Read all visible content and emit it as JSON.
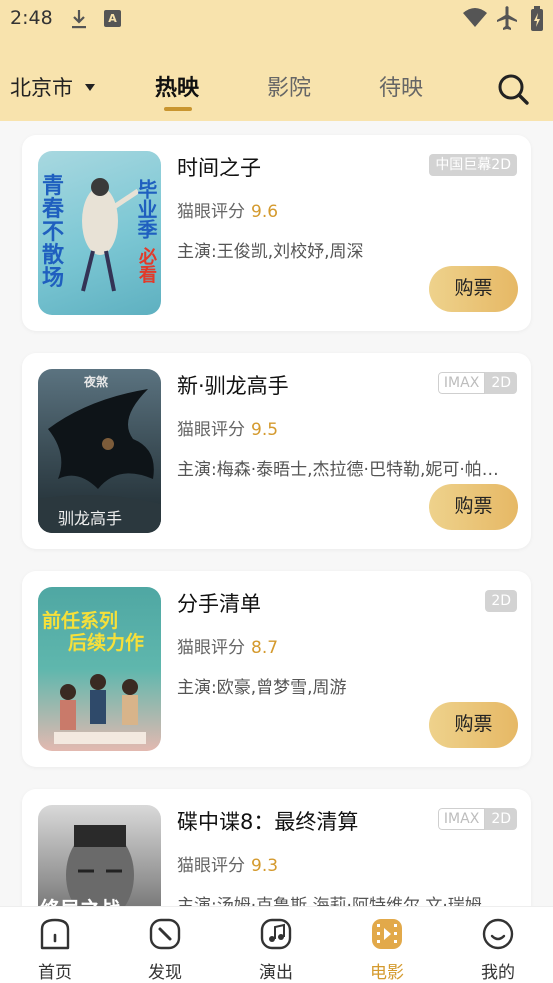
{
  "status_bar": {
    "time": "2:48",
    "a_icon": "A"
  },
  "header": {
    "city": "北京市",
    "tabs": [
      {
        "label": "热映",
        "active": true
      },
      {
        "label": "影院",
        "active": false
      },
      {
        "label": "待映",
        "active": false
      }
    ]
  },
  "movies": [
    {
      "title": "时间之子",
      "tags": [
        "中国巨幕2D"
      ],
      "rating_label": "猫眼评分",
      "score": "9.6",
      "cast": "主演:王俊凯,刘校妤,周深",
      "buy_label": "购票",
      "poster_text": [
        "青春",
        "不",
        "散场",
        "毕业季",
        "必看"
      ]
    },
    {
      "title": "新·驯龙高手",
      "tags": [
        "IMAX",
        "2D"
      ],
      "rating_label": "猫眼评分",
      "score": "9.5",
      "cast": "主演:梅森·泰晤士,杰拉德·巴特勒,妮可·帕…",
      "buy_label": "购票",
      "poster_text": [
        "夜煞",
        "驯龙高手"
      ]
    },
    {
      "title": "分手清单",
      "tags": [
        "2D"
      ],
      "rating_label": "猫眼评分",
      "score": "8.7",
      "cast": "主演:欧豪,曾梦雪,周游",
      "buy_label": "购票",
      "poster_text": [
        "前任系列",
        "后续力作"
      ]
    },
    {
      "title": "碟中谍8：最终清算",
      "tags": [
        "IMAX",
        "2D"
      ],
      "rating_label": "猫眼评分",
      "score": "9.3",
      "cast": "主演:汤姆·克鲁斯,海莉·阿特维尔,文·瑞姆",
      "buy_label": "购票",
      "poster_text": [
        "终局之战"
      ]
    }
  ],
  "bottom_nav": [
    {
      "label": "首页",
      "icon": "home-icon",
      "active": false
    },
    {
      "label": "发现",
      "icon": "compass-icon",
      "active": false
    },
    {
      "label": "演出",
      "icon": "music-icon",
      "active": false
    },
    {
      "label": "电影",
      "icon": "film-icon",
      "active": true
    },
    {
      "label": "我的",
      "icon": "smile-icon",
      "active": false
    }
  ],
  "colors": {
    "header_bg": "#f8e3ad",
    "accent": "#d49a2e",
    "button": "#e6b865"
  }
}
